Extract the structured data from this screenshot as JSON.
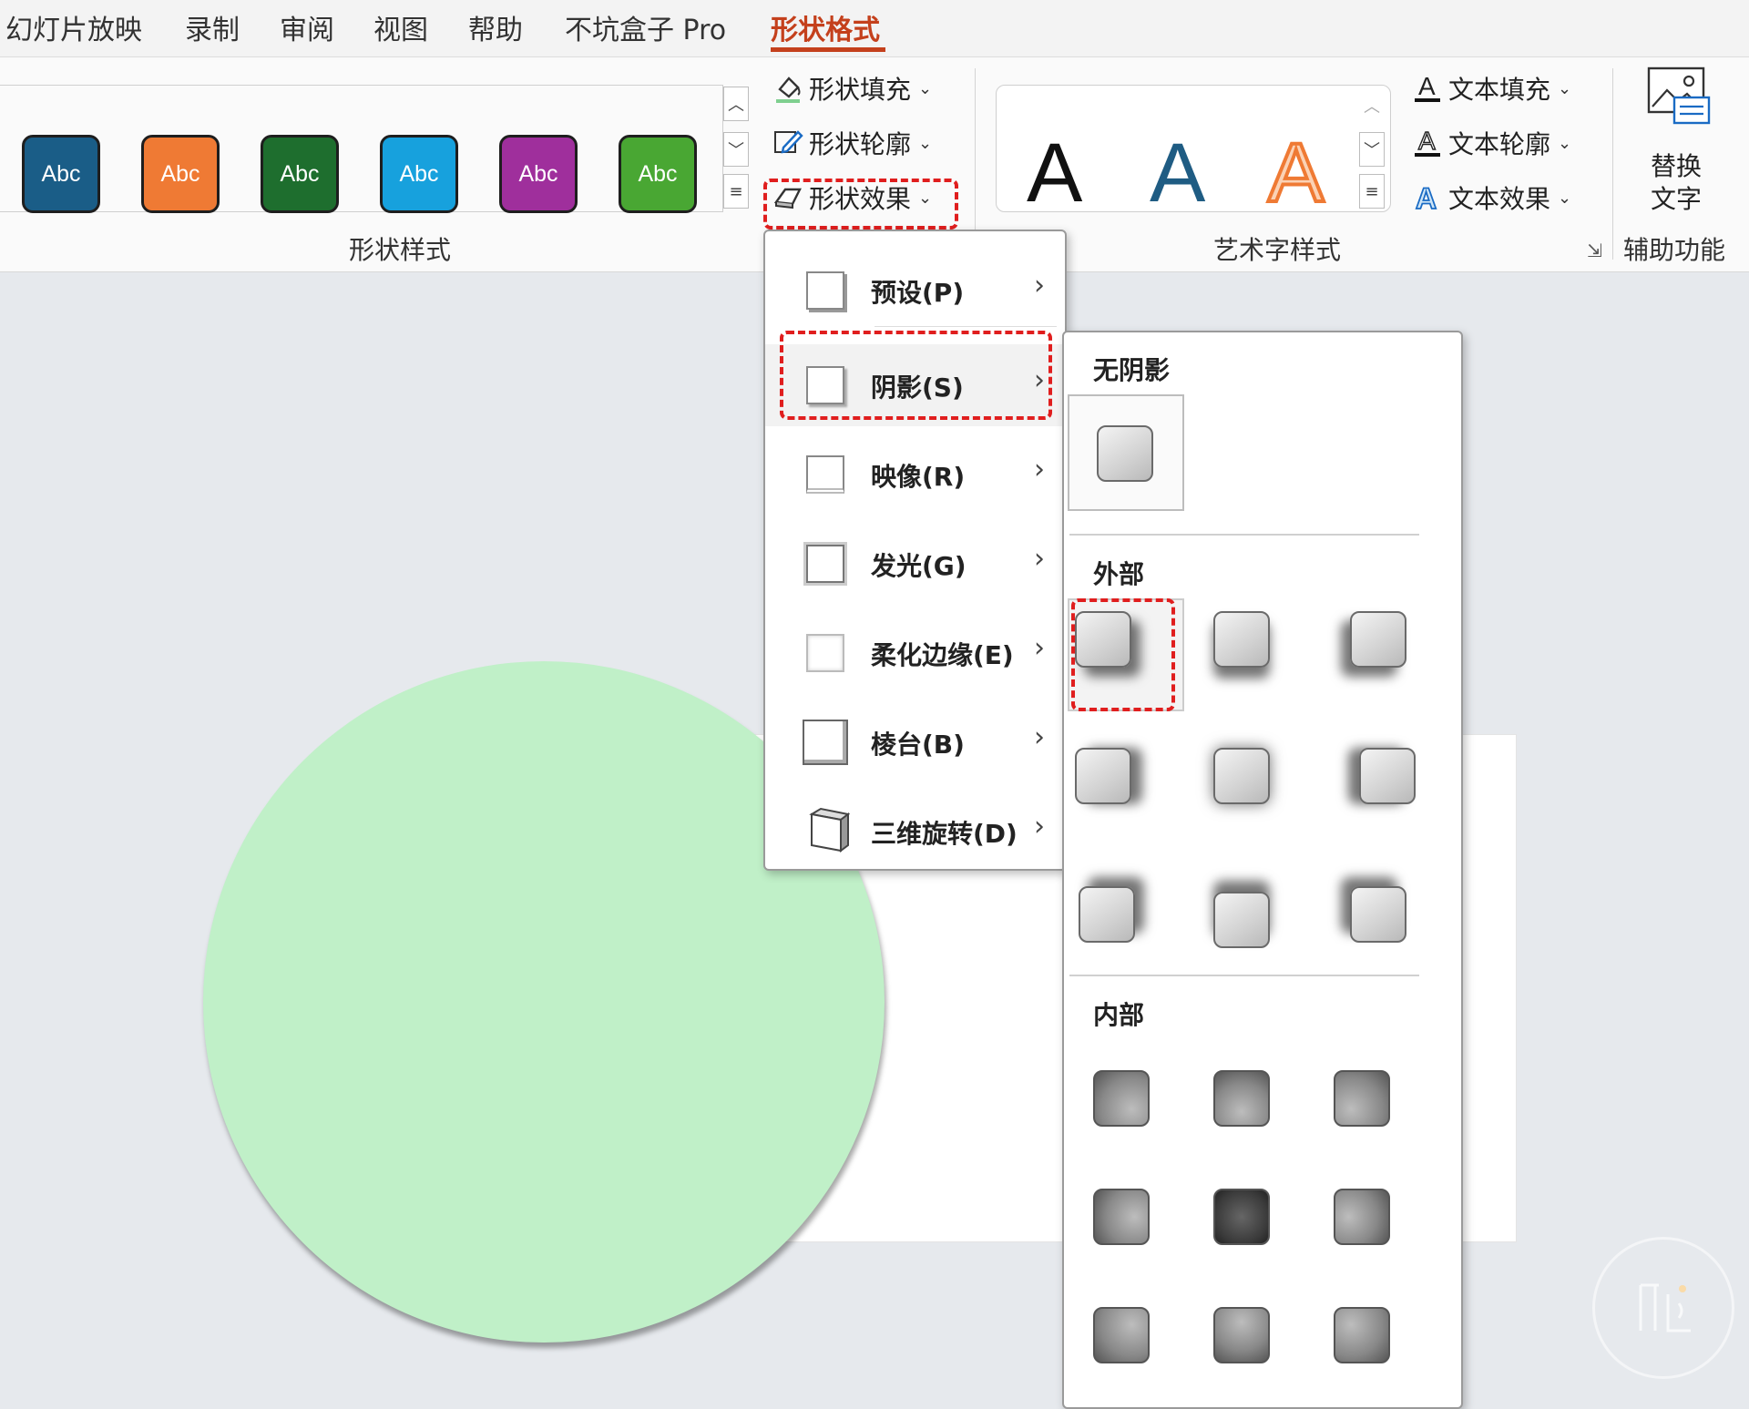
{
  "tabs": [
    {
      "label": "幻灯片放映"
    },
    {
      "label": "录制"
    },
    {
      "label": "审阅"
    },
    {
      "label": "视图"
    },
    {
      "label": "帮助"
    },
    {
      "label": "不坑盒子 Pro"
    },
    {
      "label": "形状格式",
      "active": true
    }
  ],
  "shape_styles": {
    "group_label": "形状样式",
    "tiles": [
      {
        "label": "Abc",
        "color": "#1a5d87"
      },
      {
        "label": "Abc",
        "color": "#ef7a34"
      },
      {
        "label": "Abc",
        "color": "#1e6e2e"
      },
      {
        "label": "Abc",
        "color": "#17a1dd"
      },
      {
        "label": "Abc",
        "color": "#9f2f9c"
      },
      {
        "label": "Abc",
        "color": "#49a733"
      }
    ],
    "scroll_icons": [
      "chevron-up-icon",
      "chevron-down-icon",
      "more-icon"
    ]
  },
  "shape_commands": {
    "fill": "形状填充",
    "outline": "形状轮廓",
    "effects": "形状效果"
  },
  "wordart": {
    "group_label": "艺术字样式",
    "samples": [
      {
        "label": "A",
        "color": "#111111"
      },
      {
        "label": "A",
        "color": "#1f5c83"
      },
      {
        "label": "A",
        "color": "#ef7a34"
      }
    ],
    "text_fill": "文本填充",
    "text_outline": "文本轮廓",
    "text_effects": "文本效果"
  },
  "accessibility": {
    "alt_text_line1": "替换",
    "alt_text_line2": "文字",
    "group_label": "辅助功能"
  },
  "effects_menu": {
    "items": [
      {
        "label": "预设(P)",
        "icon": "preset-icon"
      },
      {
        "label": "阴影(S)",
        "icon": "shadow-icon",
        "highlighted": true
      },
      {
        "label": "映像(R)",
        "icon": "reflection-icon"
      },
      {
        "label": "发光(G)",
        "icon": "glow-icon"
      },
      {
        "label": "柔化边缘(E)",
        "icon": "soft-edges-icon"
      },
      {
        "label": "棱台(B)",
        "icon": "bevel-icon"
      },
      {
        "label": "三维旋转(D)",
        "icon": "3d-rotation-icon"
      }
    ]
  },
  "shadow_menu": {
    "no_shadow_title": "无阴影",
    "outer_title": "外部",
    "inner_title": "内部",
    "outer_count": 9,
    "inner_count": 9
  },
  "colors": {
    "accent": "#c4401c",
    "highlight_dash": "#e01e1e",
    "slide_shape": "#c0f0c8"
  }
}
